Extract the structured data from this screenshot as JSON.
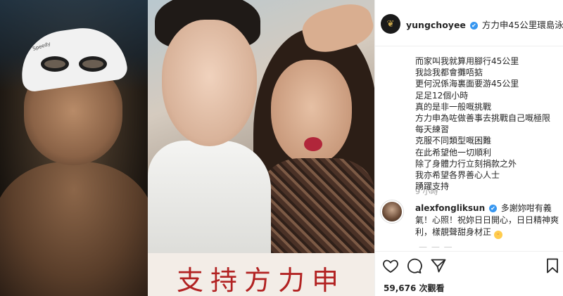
{
  "left_photo": {
    "cap_text": "Speedy"
  },
  "mid_photo": {
    "overlay_text": "支持方力申"
  },
  "post": {
    "username": "yungchoyee",
    "verified_mark": "✔",
    "location": "方力申45公里環島泳",
    "caption_lines": [
      "而家叫我就算用腳行45公里",
      "我諗我都會攤唔掂",
      "更何況係海裏面要游45公里",
      "足足12個小時",
      "真的是非一般嘅挑戰",
      "方力申為咗做善事去挑戰自己嘅極限",
      "每天練習",
      "克服不同類型嘅困難",
      "在此希望他一切順利",
      "除了身體力行立刻捐款之外",
      "我亦希望各界善心人士",
      "踴躍支持"
    ],
    "timestamp": "9 小時"
  },
  "comment": {
    "username": "alexfongliksun",
    "verified_mark": "✔",
    "text": "多謝妳咁有義氣！心照！祝妳日日開心，日日精神爽利，樣靚聲甜身材正",
    "emoji": "😋"
  },
  "more_indicator": "— — —",
  "actions": {
    "likes": "59,676 次觀看"
  },
  "icons": {
    "heart": "heart-icon",
    "comment": "comment-icon",
    "share": "share-icon",
    "bookmark": "bookmark-icon"
  }
}
